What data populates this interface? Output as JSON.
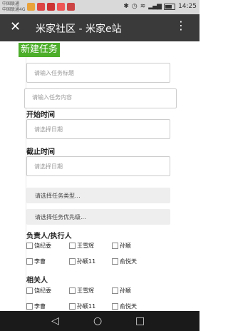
{
  "status_bar": {
    "carrier_lines": [
      "中国联通",
      "中国联通4G"
    ],
    "time": "14:25",
    "signal_text": "ᵢᵢₗ ᵢₗ"
  },
  "header": {
    "title": "米家社区 - 米家e站",
    "close_icon": "close-icon",
    "more_icon": "more-vert-icon"
  },
  "page": {
    "title": "新建任务",
    "accent": "#4cae2a"
  },
  "form": {
    "task_title_placeholder": "请输入任务标题",
    "task_content_placeholder": "请输入任务内容",
    "start_time_label": "开始时间",
    "start_date_placeholder": "请选择日期",
    "end_time_label": "截止时间",
    "end_date_placeholder": "请选择日期",
    "task_type_placeholder": "请选择任务类型...",
    "priority_placeholder": "请选择任务优先级...",
    "assignee_label": "负责人/执行人",
    "assignees": [
      "饶纪委",
      "王雪辉",
      "孙颖",
      "李曹",
      "孙颖11",
      "俞悦天"
    ],
    "related_label": "相关人",
    "related": [
      "饶纪委",
      "王雪辉",
      "孙颖",
      "李曹",
      "孙颖11",
      "俞悦天"
    ]
  },
  "nav": {
    "back": "◁",
    "home": "○",
    "recent": "□"
  }
}
